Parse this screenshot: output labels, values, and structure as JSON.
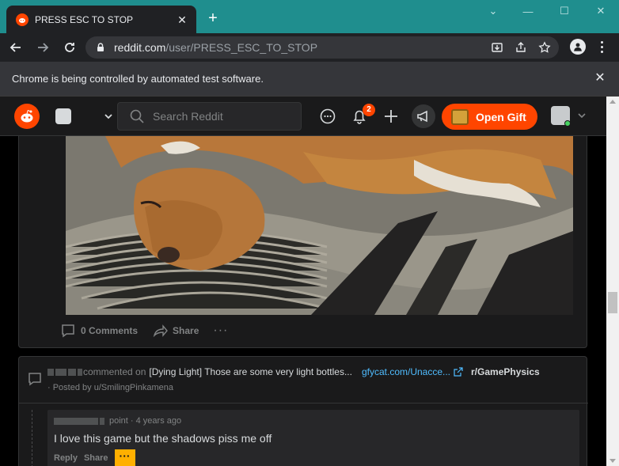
{
  "browser": {
    "tab_title": "PRESS ESC TO STOP",
    "url_host": "reddit.com",
    "url_path": "/user/PRESS_ESC_TO_STOP",
    "infobar_text": "Chrome is being controlled by automated test software."
  },
  "header": {
    "search_placeholder": "Search Reddit",
    "notification_count": "2",
    "gift_label": "Open Gift"
  },
  "post": {
    "comments_label": "0 Comments",
    "share_label": "Share",
    "more_label": "···"
  },
  "comment_entry": {
    "action_text": "commented on",
    "post_title": "[Dying Light] Those are some very light bottles...",
    "link_text": "gfycat.com/Unacce...",
    "subreddit": "r/GamePhysics",
    "posted_by": "· Posted by u/SmilingPinkamena",
    "comment": {
      "meta": "point · 4 years ago",
      "body": "I love this game but the shadows piss me off",
      "reply_label": "Reply",
      "share_label": "Share",
      "more_label": "···"
    }
  },
  "colors": {
    "accent": "#ff4500",
    "titlebar": "#1f8e8e",
    "link": "#4fbcff",
    "highlight": "#ffb000"
  }
}
